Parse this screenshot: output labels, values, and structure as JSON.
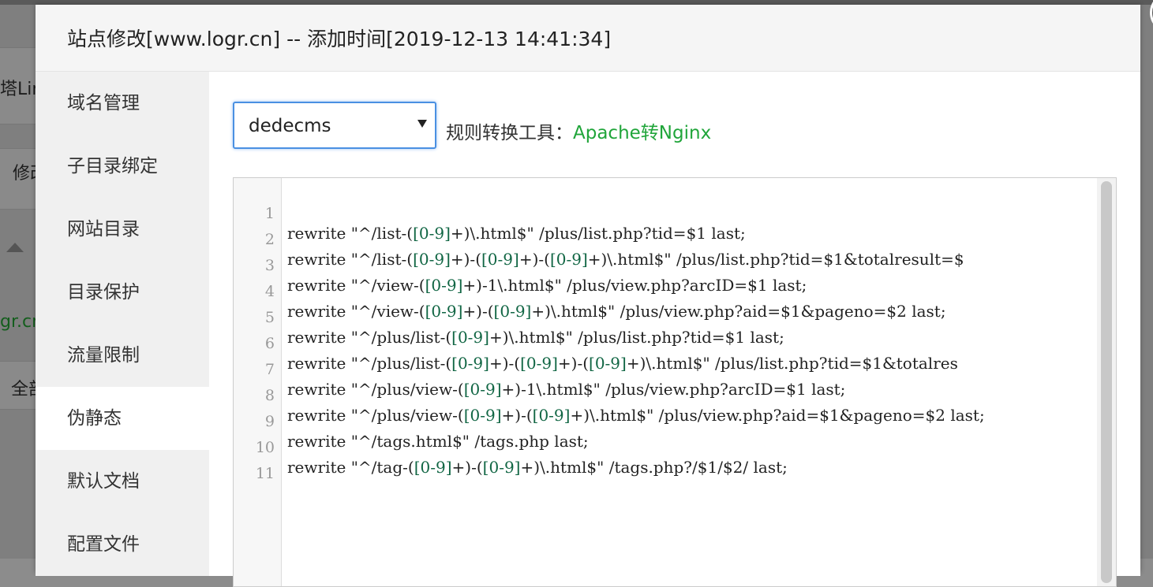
{
  "background": {
    "fragments": [
      "塔Linu",
      "修改",
      "gr.cn",
      "全部"
    ]
  },
  "modal": {
    "title": "站点修改[www.logr.cn] -- 添加时间[2019-12-13 14:41:34]",
    "close_icon": "close-icon"
  },
  "sidebar": {
    "items": [
      {
        "label": "域名管理"
      },
      {
        "label": "子目录绑定"
      },
      {
        "label": "网站目录"
      },
      {
        "label": "目录保护"
      },
      {
        "label": "流量限制"
      },
      {
        "label": "伪静态",
        "active": true
      },
      {
        "label": "默认文档"
      },
      {
        "label": "配置文件"
      }
    ]
  },
  "rewrite": {
    "template_select": {
      "value": "dedecms"
    },
    "tool_label": "规则转换工具：",
    "tool_link": "Apache转Nginx"
  },
  "editor": {
    "lines": [
      {
        "n": "1",
        "a": "rewrite \"^/list-(",
        "b": "[0-9]",
        "c": "+)\\.html$\" /plus/list.php?tid=$1 last;"
      },
      {
        "n": "2",
        "a": "rewrite \"^/list-(",
        "b": "[0-9]",
        "c": "+)-(",
        "d": "[0-9]",
        "e": "+)-(",
        "f": "[0-9]",
        "g": "+)\\.html$\" /plus/list.php?tid=$1&totalresult=$"
      },
      {
        "n": "3",
        "a": "rewrite \"^/view-(",
        "b": "[0-9]",
        "c": "+)-1\\.html$\" /plus/view.php?arcID=$1 last;"
      },
      {
        "n": "4",
        "a": "rewrite \"^/view-(",
        "b": "[0-9]",
        "c": "+)-(",
        "d": "[0-9]",
        "e": "+)\\.html$\" /plus/view.php?aid=$1&pageno=$2 last;"
      },
      {
        "n": "5",
        "a": "rewrite \"^/plus/list-(",
        "b": "[0-9]",
        "c": "+)\\.html$\" /plus/list.php?tid=$1 last;"
      },
      {
        "n": "6",
        "a": "rewrite \"^/plus/list-(",
        "b": "[0-9]",
        "c": "+)-(",
        "d": "[0-9]",
        "e": "+)-(",
        "f": "[0-9]",
        "g": "+)\\.html$\" /plus/list.php?tid=$1&totalres"
      },
      {
        "n": "7",
        "a": "rewrite \"^/plus/view-(",
        "b": "[0-9]",
        "c": "+)-1\\.html$\" /plus/view.php?arcID=$1 last;"
      },
      {
        "n": "8",
        "a": "rewrite \"^/plus/view-(",
        "b": "[0-9]",
        "c": "+)-(",
        "d": "[0-9]",
        "e": "+)\\.html$\" /plus/view.php?aid=$1&pageno=$2 last;"
      },
      {
        "n": "9",
        "a": "rewrite \"^/tags.html$\" /tags.php last;"
      },
      {
        "n": "10",
        "a": "rewrite \"^/tag-(",
        "b": "[0-9]",
        "c": "+)-(",
        "d": "[0-9]",
        "e": "+)\\.html$\" /tags.php?/$1/$2/ last;"
      },
      {
        "n": "11",
        "a": ""
      }
    ]
  }
}
